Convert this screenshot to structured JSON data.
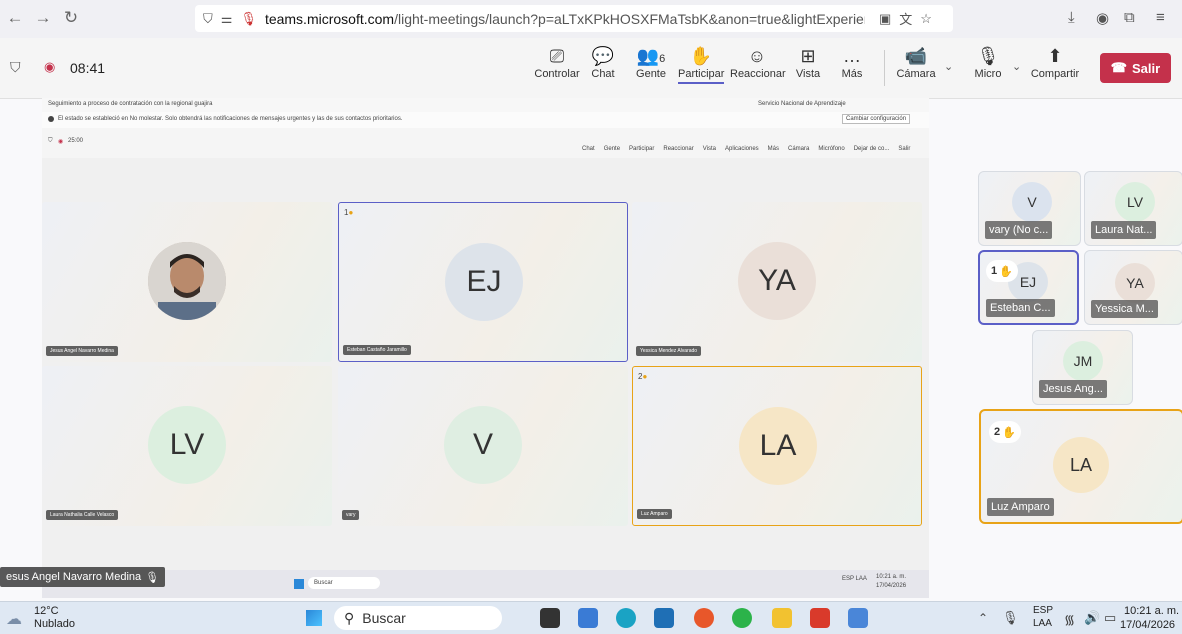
{
  "browser": {
    "url_domain": "teams.microsoft.com",
    "url_path": "/light-meetings/launch?p=aLTxKPkHOSXFMaTsbK&anon=true&lightExperience=true&correlat"
  },
  "toolbar": {
    "timer": "08:41",
    "controlar": "Controlar",
    "chat": "Chat",
    "people_count": "6",
    "people": "Gente",
    "participar": "Participar",
    "reaccionar": "Reaccionar",
    "vista": "Vista",
    "mas": "Más",
    "camara": "Cámara",
    "micro": "Micro",
    "compartir": "Compartir",
    "salir": "Salir"
  },
  "inner": {
    "window_title": "Seguimiento a proceso de contratación con la regional guajira",
    "window_app": "Servicio Nacional de Aprendizaje",
    "notice": "El estado se estableció en No molestar. Solo obtendrá las notificaciones de mensajes urgentes y las de sus contactos prioritarios.",
    "notice_button": "Cambiar configuración",
    "timer": "25:00",
    "toolbar_items": [
      "Chat",
      "Gente",
      "Participar",
      "Reaccionar",
      "Vista",
      "Aplicaciones",
      "Más",
      "Cámara",
      "Micrófono",
      "Dejar de co...",
      "Salir"
    ],
    "tiles": [
      {
        "initials": "",
        "name": "Jesus Angel Navarro Medina",
        "hand": ""
      },
      {
        "initials": "EJ",
        "name": "Esteban Castaño Jaramillo",
        "hand": "1"
      },
      {
        "initials": "YA",
        "name": "Yessica Mendez Alvarado",
        "hand": ""
      },
      {
        "initials": "LV",
        "name": "Laura Nathalia Calle Velasco",
        "hand": ""
      },
      {
        "initials": "V",
        "name": "vary",
        "hand": ""
      },
      {
        "initials": "LA",
        "name": "Luz Amparo",
        "hand": "2"
      }
    ],
    "taskbar_search": "Buscar",
    "taskbar_time": "10:21 a. m.",
    "taskbar_date": "17/04/2026",
    "taskbar_lang": "ESP LAA",
    "overlay_name": "esus Angel Navarro Medina"
  },
  "right_panel": [
    {
      "initials": "V",
      "name": "vary (No c...",
      "hand": ""
    },
    {
      "initials": "LV",
      "name": "Laura Nat...",
      "hand": ""
    },
    {
      "initials": "EJ",
      "name": "Esteban C...",
      "hand": "1"
    },
    {
      "initials": "YA",
      "name": "Yessica M...",
      "hand": ""
    },
    {
      "initials": "JM",
      "name": "Jesus Ang...",
      "hand": ""
    },
    {
      "initials": "LA",
      "name": "Luz Amparo",
      "hand": "2"
    }
  ],
  "taskbar": {
    "temp": "12°C",
    "weather": "Nublado",
    "search": "Buscar",
    "lang1": "ESP",
    "lang2": "LAA",
    "time": "10:21 a. m.",
    "date": "17/04/2026"
  },
  "colors": {
    "accent": "#5b5fc7",
    "leave": "#c4314b",
    "hand": "#e8a317"
  }
}
